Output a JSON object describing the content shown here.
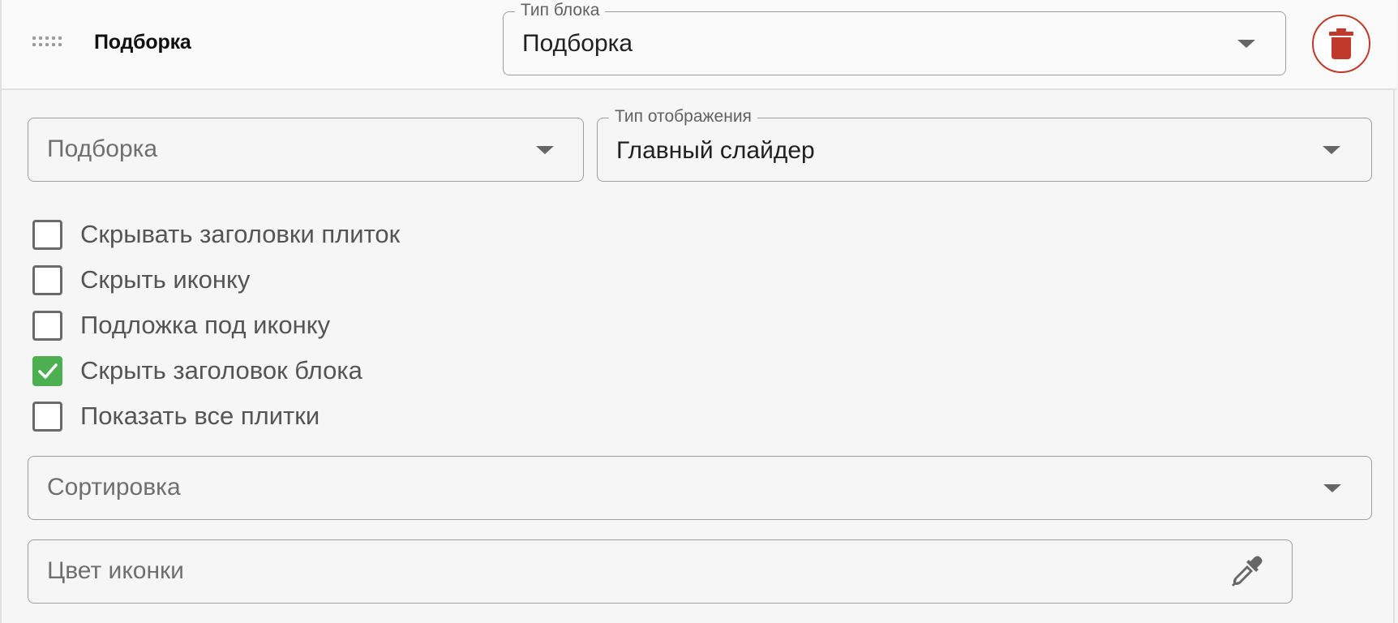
{
  "block": {
    "title": "Подборка",
    "type_field": {
      "legend": "Тип блока",
      "value": "Подборка"
    },
    "delete_icon": "trash-icon",
    "delete_color": "#c0392b"
  },
  "selection_field": {
    "placeholder": "Подборка"
  },
  "display_field": {
    "legend": "Тип отображения",
    "value": "Главный слайдер"
  },
  "checkboxes": [
    {
      "label": "Скрывать заголовки плиток",
      "checked": false
    },
    {
      "label": "Скрыть иконку",
      "checked": false
    },
    {
      "label": "Подложка под иконку",
      "checked": false
    },
    {
      "label": "Скрыть заголовок блока",
      "checked": true
    },
    {
      "label": "Показать все плитки",
      "checked": false
    }
  ],
  "sort_field": {
    "placeholder": "Сортировка"
  },
  "icon_color_field": {
    "placeholder": "Цвет иконки",
    "icon": "eyedropper-icon"
  },
  "colors": {
    "checked": "#4caf50",
    "delete": "#c0392b"
  }
}
